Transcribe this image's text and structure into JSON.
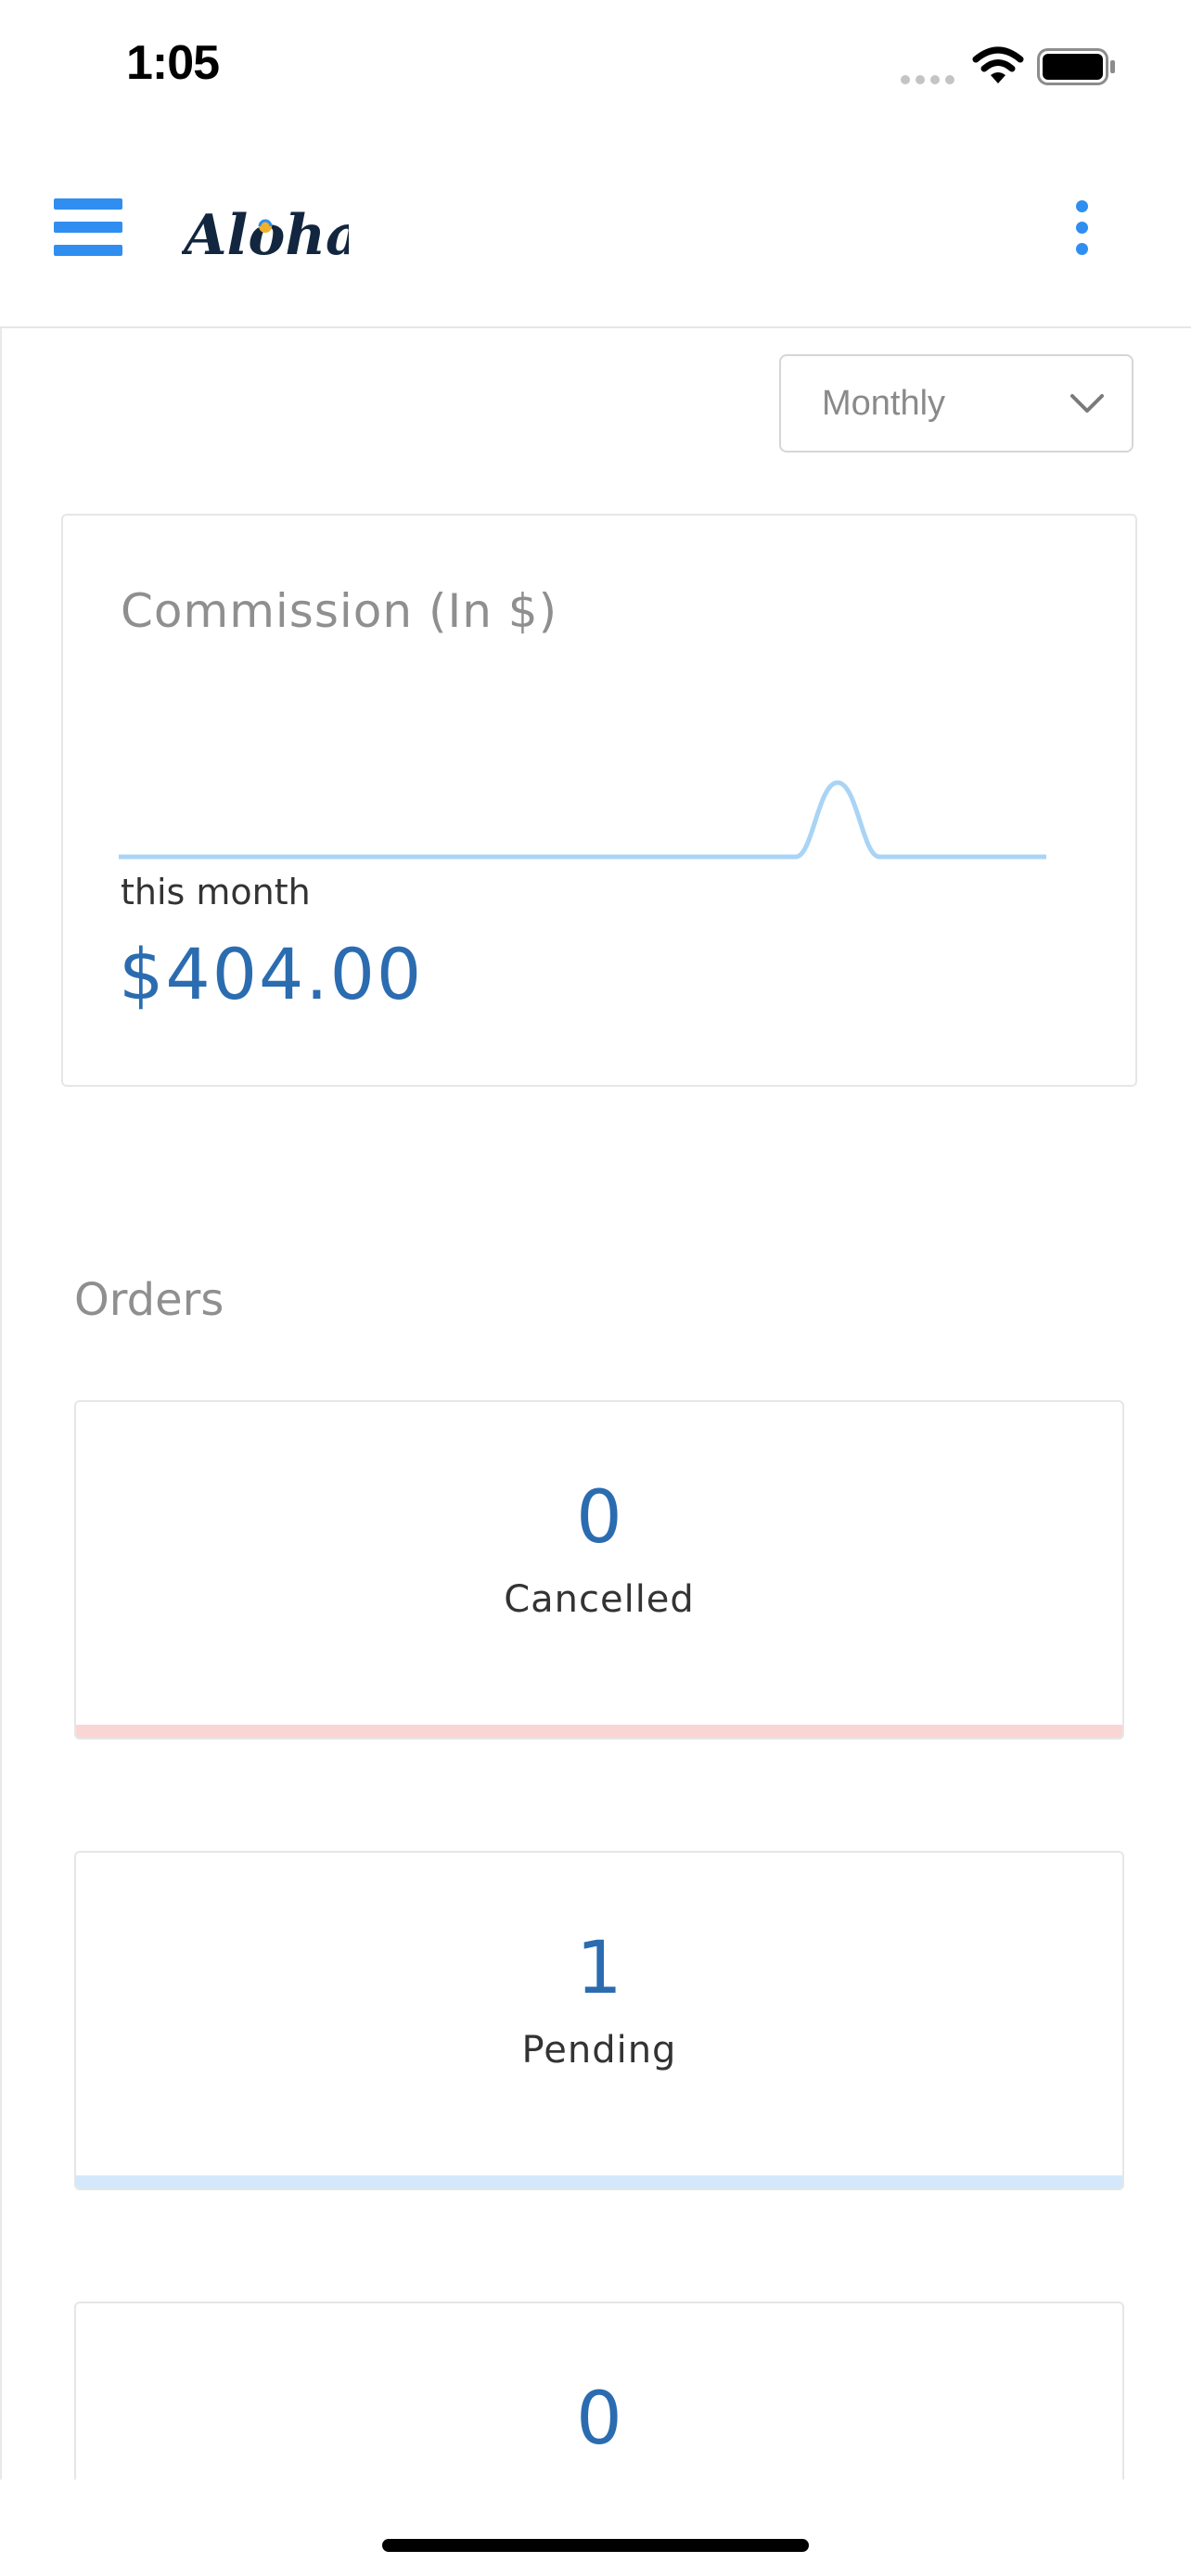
{
  "status_bar": {
    "time": "1:05",
    "icons": [
      "signal-dots-icon",
      "wifi-icon",
      "battery-icon"
    ]
  },
  "header": {
    "menu_icon": "hamburger-menu-icon",
    "logo_text": "Aloha",
    "more_icon": "vertical-dots-icon"
  },
  "filters": {
    "period": "Monthly",
    "period_icon": "chevron-down-icon"
  },
  "commission": {
    "title": "Commission (In $)",
    "caption": "this month",
    "value": "$404.00"
  },
  "orders": {
    "heading": "Orders",
    "cards": [
      {
        "count": "0",
        "label": "Cancelled",
        "accent": "#f9d6d3"
      },
      {
        "count": "1",
        "label": "Pending",
        "accent": "#d3e8fb"
      },
      {
        "count": "0",
        "label": "",
        "accent": "#ffffff"
      }
    ]
  },
  "colors": {
    "accent_blue": "#2f8ef0",
    "value_blue": "#2b6cb0",
    "sparkline": "#a9d4f5",
    "cancelled_accent": "#f9d6d3",
    "pending_accent": "#d3e8fb"
  }
}
